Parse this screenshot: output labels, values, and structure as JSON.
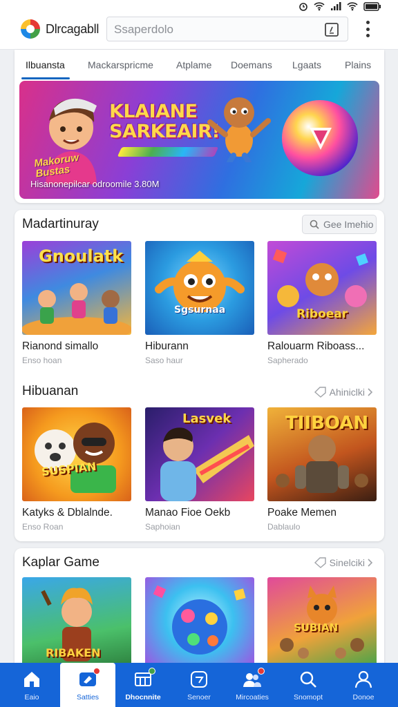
{
  "app": {
    "title": "Dlrcagabll"
  },
  "search": {
    "placeholder": "Ssaperdolo"
  },
  "tabs": [
    {
      "label": "Ilbuansta",
      "active": true
    },
    {
      "label": "Mackarspricme",
      "active": false
    },
    {
      "label": "Atplame",
      "active": false
    },
    {
      "label": "Doemans",
      "active": false
    },
    {
      "label": "Lgaats",
      "active": false
    },
    {
      "label": "Plains",
      "active": false
    }
  ],
  "hero": {
    "title": "KLAIANE SARKEAIR!",
    "badge": "Makoruw Bustas",
    "caption": "Hisanonepilcar odroomile 3.80M"
  },
  "sections": [
    {
      "title": "Madartinuray",
      "more_label": "Gee Imehio",
      "games": [
        {
          "name": "Rianond simallo",
          "subtitle": "Enso hoan",
          "art_text": "Gnoulatk"
        },
        {
          "name": "Hiburann",
          "subtitle": "Saso haur",
          "art_text": "Sgsurnaa"
        },
        {
          "name": "Ralouarm Riboass...",
          "subtitle": "Sapherado",
          "art_text": "Riboear"
        }
      ]
    },
    {
      "title": "Hibuanan",
      "more_label": "Ahiniclki",
      "games": [
        {
          "name": "Katyks & Dblalnde.",
          "subtitle": "Enso Roan",
          "art_text": "SUSPIAN"
        },
        {
          "name": "Manao Fioe Oekb",
          "subtitle": "Saphoian",
          "art_text": "Lasvek"
        },
        {
          "name": "Poake Memen",
          "subtitle": "Dablaulo",
          "art_text": "TIIBOAN"
        }
      ]
    },
    {
      "title": "Kaplar Game",
      "more_label": "Sinelciki",
      "games": [
        {
          "name": "",
          "subtitle": "",
          "art_text": "RIBAKEN"
        },
        {
          "name": "",
          "subtitle": "",
          "art_text": ""
        },
        {
          "name": "",
          "subtitle": "",
          "art_text": "SUBIAN"
        }
      ]
    }
  ],
  "bottom_nav": [
    {
      "label": "Eaio",
      "icon": "home-icon"
    },
    {
      "label": "Satties",
      "icon": "tag-icon",
      "selected": true
    },
    {
      "label": "Dhocnnite",
      "icon": "grid-icon",
      "highlight": true
    },
    {
      "label": "Senoer",
      "icon": "chat-icon"
    },
    {
      "label": "Mircoaties",
      "icon": "people-icon"
    },
    {
      "label": "Snomopt",
      "icon": "search-icon"
    },
    {
      "label": "Donoe",
      "icon": "person-icon"
    }
  ],
  "colors": {
    "primary": "#1565d8",
    "active_tab_indicator": "#1565c0",
    "badge": "#e53935"
  }
}
